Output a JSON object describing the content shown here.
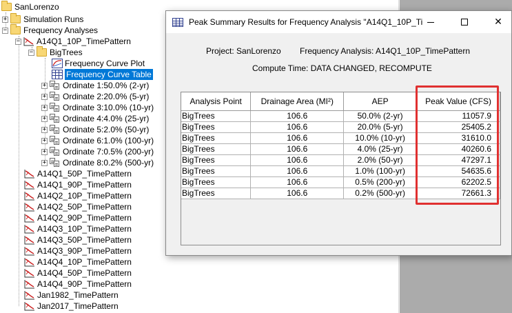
{
  "tree": {
    "root": "SanLorenzo",
    "simulation_runs": "Simulation Runs",
    "frequency_analyses": "Frequency Analyses",
    "selected_analysis": "A14Q1_10P_TimePattern",
    "bigtrees": "BigTrees",
    "curve_plot": "Frequency Curve Plot",
    "curve_table": "Frequency Curve Table",
    "ordinates": [
      "Ordinate 1:50.0% (2-yr)",
      "Ordinate 2:20.0% (5-yr)",
      "Ordinate 3:10.0% (10-yr)",
      "Ordinate 4:4.0% (25-yr)",
      "Ordinate 5:2.0% (50-yr)",
      "Ordinate 6:1.0% (100-yr)",
      "Ordinate 7:0.5% (200-yr)",
      "Ordinate 8:0.2% (500-yr)"
    ],
    "other_analyses": [
      "A14Q1_50P_TimePattern",
      "A14Q1_90P_TimePattern",
      "A14Q2_10P_TimePattern",
      "A14Q2_50P_TimePattern",
      "A14Q2_90P_TimePattern",
      "A14Q3_10P_TimePattern",
      "A14Q3_50P_TimePattern",
      "A14Q3_90P_TimePattern",
      "A14Q4_10P_TimePattern",
      "A14Q4_50P_TimePattern",
      "A14Q4_90P_TimePattern",
      "Jan1982_TimePattern",
      "Jan2017_TimePattern"
    ]
  },
  "dialog": {
    "title": "Peak Summary Results for Frequency Analysis \"A14Q1_10P_Ti...",
    "project": "Project: SanLorenzo",
    "frequency_analysis": "Frequency Analysis: A14Q1_10P_TimePattern",
    "compute_time": "Compute Time: DATA CHANGED, RECOMPUTE",
    "columns": [
      "Analysis Point",
      "Drainage Area (MI²)",
      "AEP",
      "Peak Value (CFS)"
    ],
    "rows": [
      [
        "BigTrees",
        "106.6",
        "50.0% (2-yr)",
        "11057.9"
      ],
      [
        "BigTrees",
        "106.6",
        "20.0% (5-yr)",
        "25405.2"
      ],
      [
        "BigTrees",
        "106.6",
        "10.0% (10-yr)",
        "31610.0"
      ],
      [
        "BigTrees",
        "106.6",
        "4.0% (25-yr)",
        "40260.6"
      ],
      [
        "BigTrees",
        "106.6",
        "2.0% (50-yr)",
        "47297.1"
      ],
      [
        "BigTrees",
        "106.6",
        "1.0% (100-yr)",
        "54635.6"
      ],
      [
        "BigTrees",
        "106.6",
        "0.5% (200-yr)",
        "62202.5"
      ],
      [
        "BigTrees",
        "106.6",
        "0.2% (500-yr)",
        "72661.3"
      ]
    ]
  },
  "colors": {
    "selection": "#0078d7",
    "highlight": "#e03030",
    "folder": "#f8d775"
  }
}
